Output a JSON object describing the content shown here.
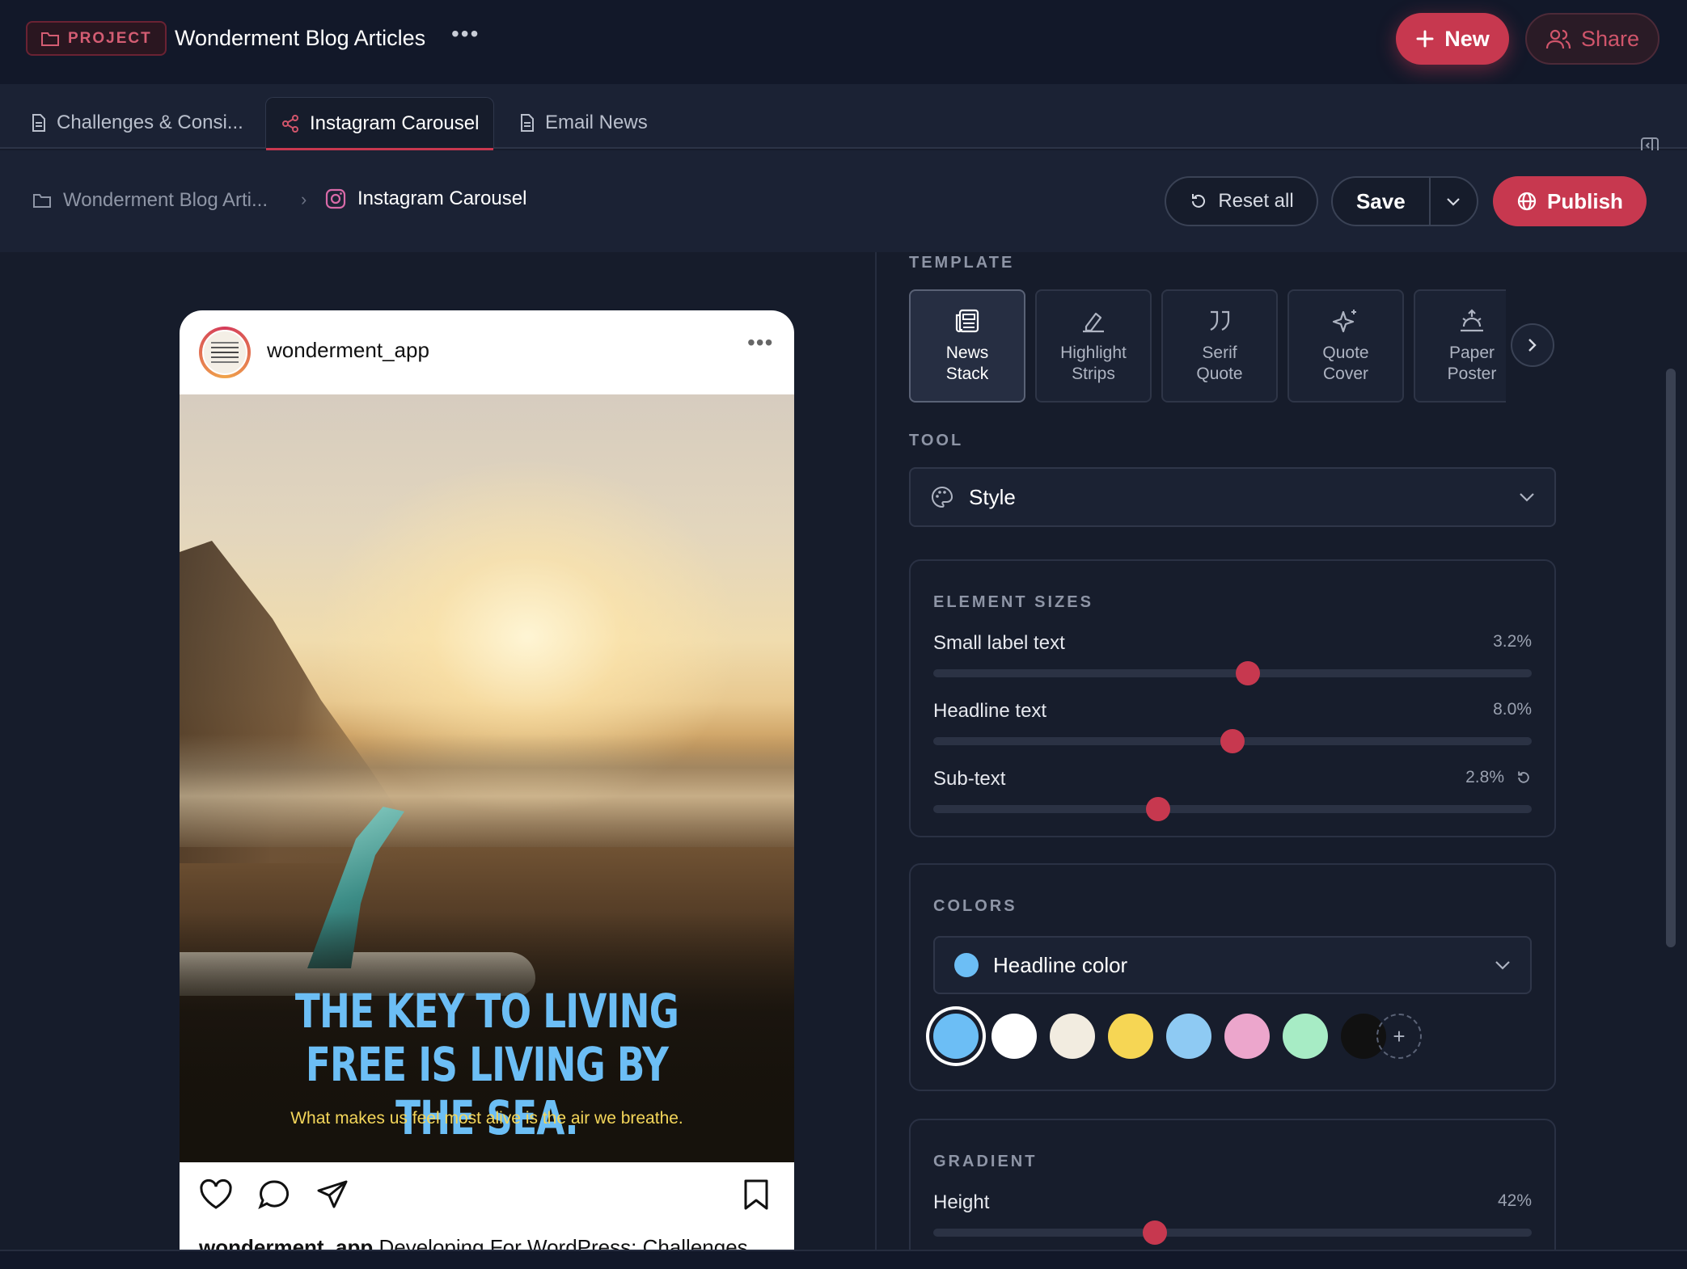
{
  "header": {
    "project_badge": "PROJECT",
    "project_title": "Wonderment Blog Articles",
    "more": "•••",
    "new_label": "New",
    "share_label": "Share"
  },
  "tabs": [
    {
      "label": "Challenges & Consi...",
      "active": false
    },
    {
      "label": "Instagram Carousel",
      "active": true
    },
    {
      "label": "Email News",
      "active": false
    }
  ],
  "breadcrumb": {
    "parent": "Wonderment Blog Arti...",
    "separator": "›",
    "current": "Instagram Carousel"
  },
  "actions": {
    "reset_label": "Reset all",
    "save_label": "Save",
    "publish_label": "Publish"
  },
  "post": {
    "username": "wonderment_app",
    "more": "•••",
    "headline": "THE KEY TO LIVING FREE IS LIVING BY THE SEA.",
    "subtext": "What makes us feel most alive is the air we breathe.",
    "caption_user": "wonderment_app",
    "caption_text": " Developing For WordPress: Challenges"
  },
  "settings": {
    "template_label": "TEMPLATE",
    "templates": [
      {
        "line1": "News",
        "line2": "Stack",
        "icon": "newspaper-icon",
        "active": true
      },
      {
        "line1": "Highlight",
        "line2": "Strips",
        "icon": "highlighter-icon",
        "active": false
      },
      {
        "line1": "Serif",
        "line2": "Quote",
        "icon": "quote-icon",
        "active": false
      },
      {
        "line1": "Quote",
        "line2": "Cover",
        "icon": "sparkles-icon",
        "active": false
      },
      {
        "line1": "Paper",
        "line2": "Poster",
        "icon": "sunrise-icon",
        "active": false
      }
    ],
    "tool_label": "TOOL",
    "tool_value": "Style",
    "element_sizes_label": "ELEMENT SIZES",
    "sliders": [
      {
        "label": "Small label text",
        "value_text": "3.2%",
        "position": 0.525
      },
      {
        "label": "Headline text",
        "value_text": "8.0%",
        "position": 0.5
      },
      {
        "label": "Sub-text",
        "value_text": "2.8%",
        "position": 0.375
      }
    ],
    "colors_label": "COLORS",
    "color_target": "Headline color",
    "color_target_swatch": "#6cbef5",
    "swatches": [
      "#6cbef5",
      "#ffffff",
      "#f2ece0",
      "#f6d654",
      "#8ecaf3",
      "#eca6cc",
      "#a7ecc5",
      "#111111"
    ],
    "selected_swatch": 0,
    "gradient_label": "GRADIENT",
    "gradient_height_label": "Height",
    "gradient_height_value": "42%",
    "gradient_height_position": 0.37
  },
  "colors": {
    "accent": "#c7384f",
    "background": "#161c2b"
  }
}
